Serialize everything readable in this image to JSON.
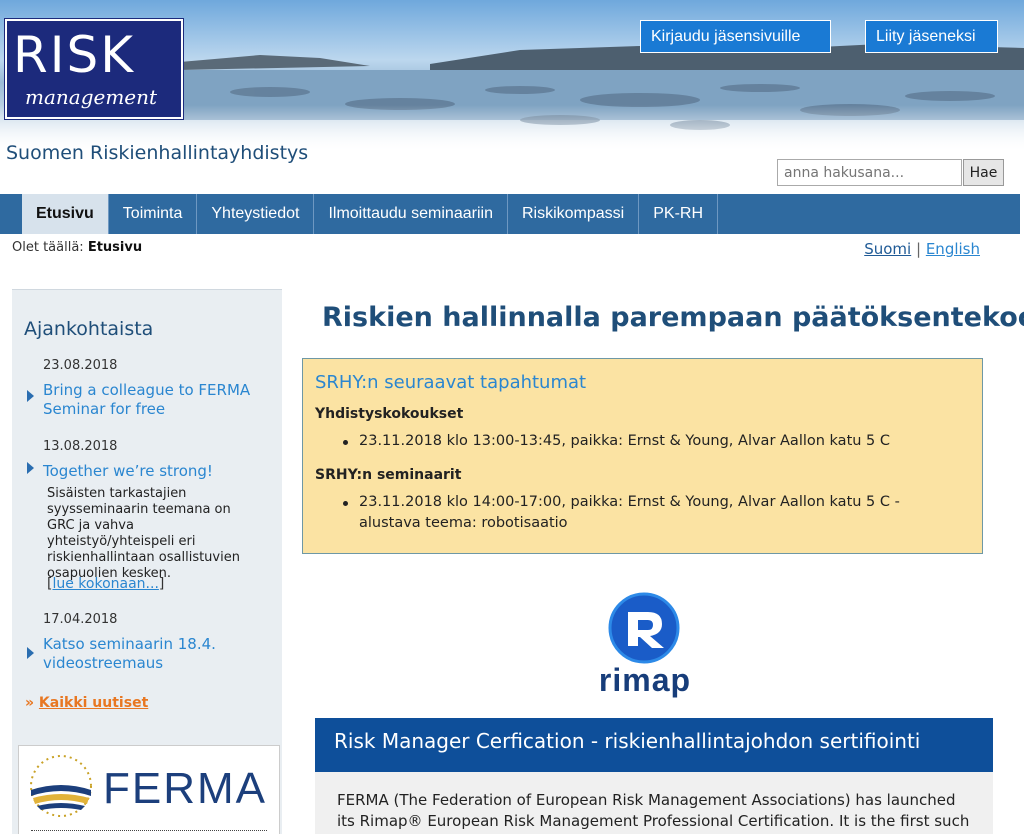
{
  "header": {
    "logo_text": "RISK",
    "logo_subtext": "management",
    "site_name": "Suomen Riskienhallintayhdistys",
    "login_button": "Kirjaudu jäsensivuille",
    "join_button": "Liity jäseneksi",
    "search_placeholder": "anna hakusana...",
    "search_button": "Hae"
  },
  "nav": {
    "items": [
      {
        "label": "Etusivu",
        "active": true
      },
      {
        "label": "Toiminta"
      },
      {
        "label": "Yhteystiedot"
      },
      {
        "label": "Ilmoittaudu seminaariin"
      },
      {
        "label": "Riskikompassi"
      },
      {
        "label": "PK-RH"
      }
    ]
  },
  "breadcrumb": {
    "prefix": "Olet täällä:",
    "current": "Etusivu"
  },
  "languages": {
    "fi": "Suomi",
    "separator": "|",
    "en": "English"
  },
  "sidebar": {
    "title": "Ajankohtaista",
    "news": [
      {
        "date": "23.08.2018",
        "title": "Bring a colleague to FERMA Seminar for free"
      },
      {
        "date": "13.08.2018",
        "title": "Together we’re strong!",
        "body": "Sisäisten tarkastajien syysseminaarin teemana on GRC ja vahva yhteistyö/yhteispeli eri riskienhallintaan osallistuvien osapuolien kesken.",
        "read_more": "lue kokonaan..."
      },
      {
        "date": "17.04.2018",
        "title": "Katso seminaarin 18.4. videostreemaus"
      }
    ],
    "all_news": "Kaikki uutiset",
    "all_news_prefix": "»",
    "ferma_logo_text": "FERMA"
  },
  "main": {
    "title": "Riskien hallinnalla parempaan päätöksentekoon",
    "events": {
      "title": "SRHY:n seuraavat tapahtumat",
      "sections": [
        {
          "heading": "Yhdistyskokoukset",
          "items": [
            "23.11.2018 klo 13:00-13:45, paikka: Ernst & Young, Alvar Aallon katu 5 C"
          ]
        },
        {
          "heading": "SRHY:n seminaarit",
          "items": [
            "23.11.2018 klo 14:00-17:00, paikka: Ernst & Young, Alvar Aallon katu 5 C - alustava teema: robotisaatio"
          ]
        }
      ]
    },
    "rimap_logo_text": "rimap",
    "cert": {
      "title": "Risk Manager Cerfication - riskienhallintajohdon sertifiointi",
      "body": "FERMA (The Federation of European Risk Management Associations) has launched its Rimap® European Risk Management Professional Certification. It is the first such"
    }
  },
  "colors": {
    "nav_bg": "#2f6aa0",
    "accent_blue": "#2a86d0",
    "title_blue": "#1f4e79",
    "events_bg": "#fbe3a3",
    "cert_header_bg": "#0e4f9a",
    "orange": "#e87722"
  }
}
